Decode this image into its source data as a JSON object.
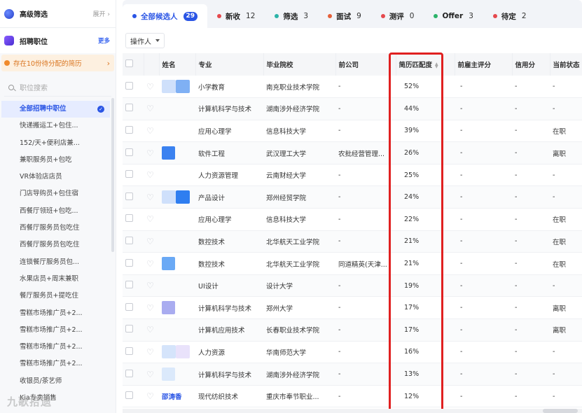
{
  "sidebar": {
    "header_title": "高级筛选",
    "expand_label": "展开",
    "job_title": "招聘职位",
    "job_more": "更多",
    "alert_text": "存在10份待分配的简历",
    "search_placeholder": "职位搜索",
    "items": [
      "全部招聘中职位",
      "快递搬运工+包住...",
      "152/天+便利店兼...",
      "兼职服务员+包吃",
      "VR体验店店员",
      "门店导购员+包住宿",
      "西餐厅领班+包吃...",
      "西餐厅服务员包吃住",
      "西餐厅服务员包吃住",
      "连锁餐厅服务员包...",
      "水果店员+周末兼职",
      "餐厅服务员+提吃住",
      "雪糕市场推广员+2...",
      "雪糕市场推广员+2...",
      "雪糕市场推广员+2...",
      "雪糕市场推广员+2...",
      "收银员/茶艺师",
      "Kia专卖销售"
    ],
    "watermark": "九歌拾遗"
  },
  "tabs": [
    {
      "label": "全部候选人",
      "count": "29",
      "color": "#2a55e5"
    },
    {
      "label": "新收",
      "count": "12",
      "color": "#e5484d"
    },
    {
      "label": "筛选",
      "count": "3",
      "color": "#2bb3a8"
    },
    {
      "label": "面试",
      "count": "9",
      "color": "#e5603a"
    },
    {
      "label": "测评",
      "count": "0",
      "color": "#e5484d"
    },
    {
      "label": "Offer",
      "count": "3",
      "color": "#2bb36a"
    },
    {
      "label": "待定",
      "count": "2",
      "color": "#e5484d"
    }
  ],
  "toolbar": {
    "operator_label": "操作人"
  },
  "table": {
    "headers": [
      "姓名",
      "专业",
      "毕业院校",
      "前公司",
      "简历匹配度",
      "前雇主评分",
      "信用分",
      "当前状态"
    ],
    "rows": [
      {
        "name": "",
        "major": "小学教育",
        "school": "南充职业技术学院",
        "prev": "-",
        "match": "52%",
        "score": "-",
        "credit": "-",
        "status": "-",
        "av": [
          "#cfe0fb",
          "#7fb0f4"
        ]
      },
      {
        "name": "",
        "major": "计算机科学与技术",
        "school": "湖南涉外经济学院",
        "prev": "-",
        "match": "44%",
        "score": "-",
        "credit": "-",
        "status": "-",
        "av": []
      },
      {
        "name": "",
        "major": "应用心理学",
        "school": "信息科技大学",
        "prev": "-",
        "match": "39%",
        "score": "-",
        "credit": "-",
        "status": "在职",
        "av": []
      },
      {
        "name": "",
        "major": "软件工程",
        "school": "武汉理工大学",
        "prev": "农批经营管理...",
        "match": "26%",
        "score": "-",
        "credit": "-",
        "status": "离职",
        "av": [
          "#3b82f0"
        ]
      },
      {
        "name": "",
        "major": "人力资源管理",
        "school": "云南财经大学",
        "prev": "-",
        "match": "25%",
        "score": "-",
        "credit": "-",
        "status": "-",
        "av": []
      },
      {
        "name": "",
        "major": "产品设计",
        "school": "郑州经贸学院",
        "prev": "-",
        "match": "24%",
        "score": "-",
        "credit": "-",
        "status": "-",
        "av": [
          "#cfe0fb",
          "#2f7ef0"
        ]
      },
      {
        "name": "",
        "major": "应用心理学",
        "school": "信息科技大学",
        "prev": "-",
        "match": "22%",
        "score": "-",
        "credit": "-",
        "status": "在职",
        "av": []
      },
      {
        "name": "",
        "major": "数控技术",
        "school": "北华航天工业学院",
        "prev": "-",
        "match": "21%",
        "score": "-",
        "credit": "-",
        "status": "在职",
        "av": []
      },
      {
        "name": "",
        "major": "数控技术",
        "school": "北华航天工业学院",
        "prev": "同道精英(天津...",
        "match": "21%",
        "score": "-",
        "credit": "-",
        "status": "在职",
        "av": [
          "#6aa9f5"
        ]
      },
      {
        "name": "",
        "major": "UI设计",
        "school": "设计大学",
        "prev": "-",
        "match": "19%",
        "score": "-",
        "credit": "-",
        "status": "-",
        "av": []
      },
      {
        "name": "",
        "major": "计算机科学与技术",
        "school": "郑州大学",
        "prev": "-",
        "match": "17%",
        "score": "-",
        "credit": "-",
        "status": "离职",
        "av": [
          "#a9acf0"
        ]
      },
      {
        "name": "",
        "major": "计算机应用技术",
        "school": "长春职业技术学院",
        "prev": "-",
        "match": "17%",
        "score": "-",
        "credit": "-",
        "status": "离职",
        "av": []
      },
      {
        "name": "",
        "major": "人力资源",
        "school": "华南师范大学",
        "prev": "-",
        "match": "16%",
        "score": "-",
        "credit": "-",
        "status": "-",
        "av": [
          "#d5e4fb",
          "#e9e2fb"
        ]
      },
      {
        "name": "",
        "major": "计算机科学与技术",
        "school": "湖南涉外经济学院",
        "prev": "-",
        "match": "13%",
        "score": "-",
        "credit": "-",
        "status": "-",
        "av": [
          "#dbe9fb"
        ]
      },
      {
        "name": "邵涛香",
        "major": "现代纺织技术",
        "school": "重庆市奉节职业...",
        "prev": "-",
        "match": "12%",
        "score": "-",
        "credit": "-",
        "status": "-",
        "av": []
      }
    ]
  }
}
